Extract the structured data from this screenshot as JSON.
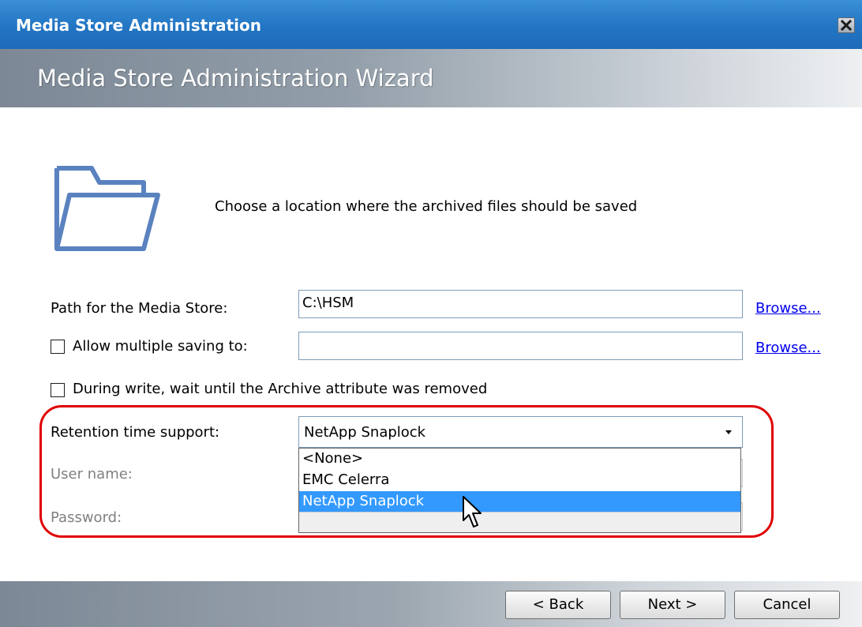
{
  "window": {
    "title": "Media Store Administration",
    "close_icon": "close-icon"
  },
  "header": {
    "title": "Media Store Administration Wizard"
  },
  "main": {
    "icon": "folder-icon",
    "instruction": "Choose a location where the archived files should be saved",
    "path": {
      "label": "Path for the Media Store:",
      "value": "C:\\HSM",
      "browse": "Browse..."
    },
    "multiple": {
      "label": "Allow multiple saving to:",
      "checked": false,
      "value": "",
      "browse": "Browse..."
    },
    "archive_attr": {
      "label": "During write, wait until the Archive attribute was removed",
      "checked": false
    },
    "retention": {
      "label": "Retention time support:",
      "selected": "NetApp Snaplock",
      "options": [
        "<None>",
        "EMC Celerra",
        "NetApp Snaplock"
      ],
      "highlighted_option": "NetApp Snaplock"
    },
    "username": {
      "label": "User name:"
    },
    "password": {
      "label": "Password:"
    }
  },
  "footer": {
    "back": "< Back",
    "next": "Next >",
    "cancel": "Cancel"
  },
  "colors": {
    "titlebar": "#2275c3",
    "selection": "#3399ff",
    "highlight_outline": "#e00000",
    "link": "#0000ee"
  }
}
